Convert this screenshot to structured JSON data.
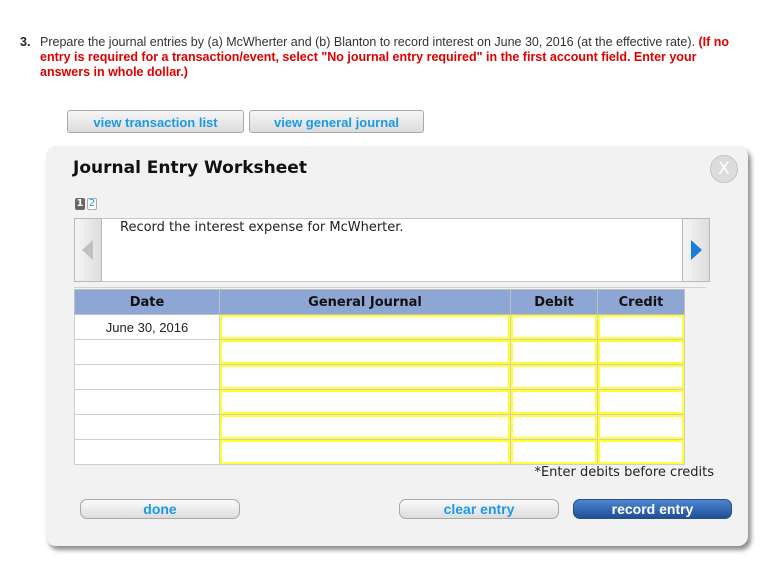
{
  "question": {
    "number": "3.",
    "text": "Prepare the journal entries by (a) McWherter and (b) Blanton to record interest on June 30, 2016 (at the effective rate).",
    "instruction": "(If no entry is required for a transaction/event, select \"No journal entry required\" in the first account field. Enter your answers in whole dollar.)"
  },
  "top_buttons": {
    "view_transaction_list": "view transaction list",
    "view_general_journal": "view general journal"
  },
  "worksheet": {
    "title": "Journal Entry Worksheet",
    "close_label": "X",
    "pages": [
      "1",
      "2"
    ],
    "active_page": "1",
    "description": "Record the interest expense for McWherter.",
    "columns": [
      "Date",
      "General Journal",
      "Debit",
      "Credit"
    ],
    "rows": [
      {
        "date": "June 30, 2016",
        "account": "",
        "debit": "",
        "credit": ""
      },
      {
        "date": "",
        "account": "",
        "debit": "",
        "credit": ""
      },
      {
        "date": "",
        "account": "",
        "debit": "",
        "credit": ""
      },
      {
        "date": "",
        "account": "",
        "debit": "",
        "credit": ""
      },
      {
        "date": "",
        "account": "",
        "debit": "",
        "credit": ""
      },
      {
        "date": "",
        "account": "",
        "debit": "",
        "credit": ""
      }
    ],
    "note": "*Enter debits before credits",
    "buttons": {
      "done": "done",
      "clear_entry": "clear entry",
      "record_entry": "record entry"
    }
  }
}
